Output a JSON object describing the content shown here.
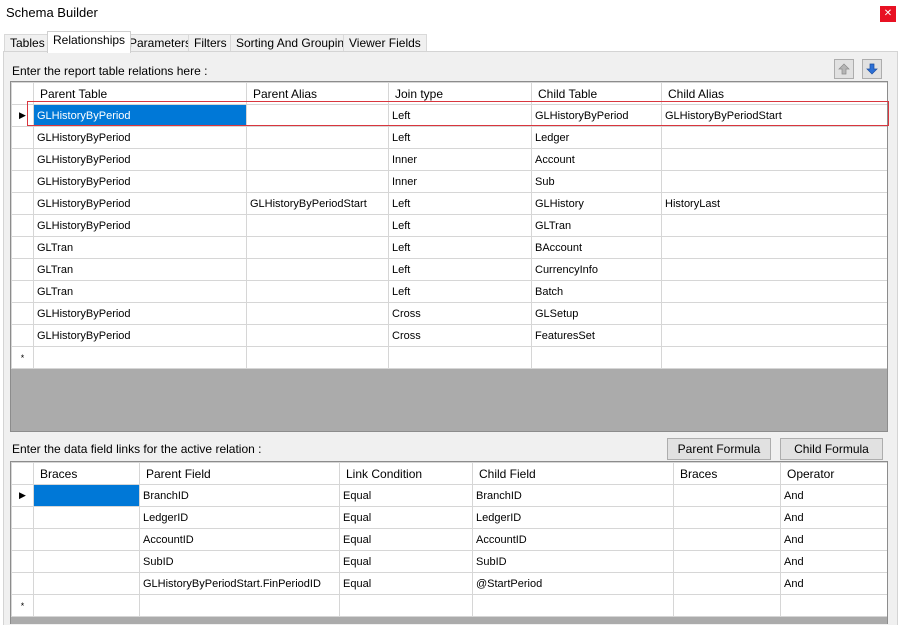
{
  "window": {
    "title": "Schema Builder"
  },
  "tabs": [
    "Tables",
    "Relationships",
    "Parameters",
    "Filters",
    "Sorting And Grouping",
    "Viewer Fields"
  ],
  "relations": {
    "label": "Enter the report table relations here :",
    "columns": [
      "Parent Table",
      "Parent Alias",
      "Join type",
      "Child Table",
      "Child Alias"
    ],
    "rows": [
      [
        "GLHistoryByPeriod",
        "",
        "Left",
        "GLHistoryByPeriod",
        "GLHistoryByPeriodStart"
      ],
      [
        "GLHistoryByPeriod",
        "",
        "Left",
        "Ledger",
        ""
      ],
      [
        "GLHistoryByPeriod",
        "",
        "Inner",
        "Account",
        ""
      ],
      [
        "GLHistoryByPeriod",
        "",
        "Inner",
        "Sub",
        ""
      ],
      [
        "GLHistoryByPeriod",
        "GLHistoryByPeriodStart",
        "Left",
        "GLHistory",
        "HistoryLast"
      ],
      [
        "GLHistoryByPeriod",
        "",
        "Left",
        "GLTran",
        ""
      ],
      [
        "GLTran",
        "",
        "Left",
        "BAccount",
        ""
      ],
      [
        "GLTran",
        "",
        "Left",
        "CurrencyInfo",
        ""
      ],
      [
        "GLTran",
        "",
        "Left",
        "Batch",
        ""
      ],
      [
        "GLHistoryByPeriod",
        "",
        "Cross",
        "GLSetup",
        ""
      ],
      [
        "GLHistoryByPeriod",
        "",
        "Cross",
        "FeaturesSet",
        ""
      ]
    ]
  },
  "links": {
    "label": "Enter the data field links for the active relation :",
    "parent_formula": "Parent Formula",
    "child_formula": "Child Formula",
    "columns": [
      "Braces",
      "Parent Field",
      "Link Condition",
      "Child Field",
      "Braces",
      "Operator"
    ],
    "rows": [
      [
        "",
        "BranchID",
        "Equal",
        "BranchID",
        "",
        "And"
      ],
      [
        "",
        "LedgerID",
        "Equal",
        "LedgerID",
        "",
        "And"
      ],
      [
        "",
        "AccountID",
        "Equal",
        "AccountID",
        "",
        "And"
      ],
      [
        "",
        "SubID",
        "Equal",
        "SubID",
        "",
        "And"
      ],
      [
        "",
        "GLHistoryByPeriodStart.FinPeriodID",
        "Equal",
        "@StartPeriod",
        "",
        "And"
      ]
    ]
  },
  "indicators": {
    "current": "▶",
    "new_row": "*"
  },
  "icons": {
    "move_up": "arrow-up-icon",
    "move_down": "arrow-down-icon"
  },
  "colors": {
    "selection": "#0078d7",
    "highlight": "#d9363e",
    "close": "#e81123"
  }
}
